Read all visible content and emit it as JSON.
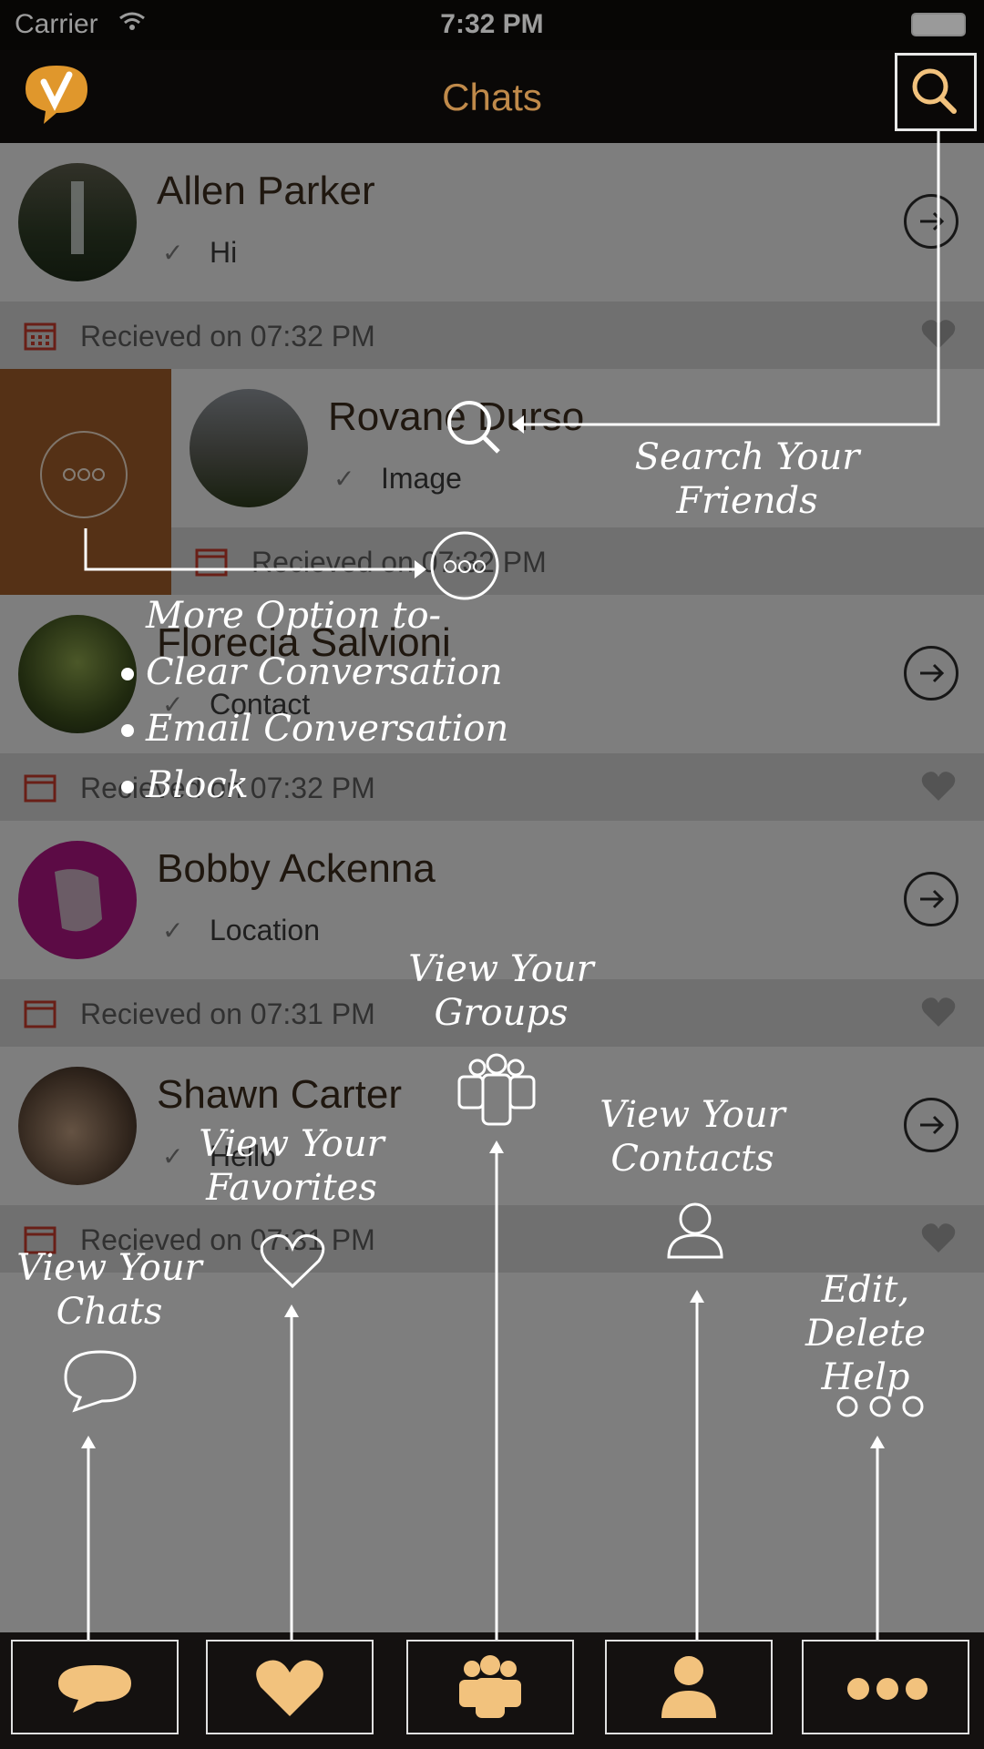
{
  "status_bar": {
    "carrier": "Carrier",
    "time": "7:32 PM"
  },
  "nav": {
    "title": "Chats"
  },
  "chats": [
    {
      "name": "Allen Parker",
      "message": "Hi",
      "received": "Recieved on 07:32 PM"
    },
    {
      "name": "Rovane Durso",
      "message": "Image",
      "received": "Recieved on 07:32 PM"
    },
    {
      "name": "Florecia Salvioni",
      "message": "Contact",
      "received": "Recieved on 07:32 PM"
    },
    {
      "name": "Bobby Ackenna",
      "message": "Location",
      "received": "Recieved on 07:31 PM"
    },
    {
      "name": "Shawn Carter",
      "message": "Hello",
      "received": "Recieved on 07:31 PM"
    }
  ],
  "annotations": {
    "search": "Search Your Friends",
    "more_title": "More Option to-",
    "more_items": [
      "Clear Conversation",
      "Email Conversation",
      "Block"
    ],
    "groups": "View Your Groups",
    "contacts": "View Your Contacts",
    "favorites": "View Your Favorites",
    "chats": "View Your Chats",
    "edit": "Edit, Delete Help"
  },
  "tabs": [
    "chats-tab",
    "favorites-tab",
    "groups-tab",
    "contacts-tab",
    "more-tab"
  ],
  "colors": {
    "accent": "#f2c27d",
    "brown": "#9b5a28",
    "overlay": "rgba(0,0,0,0.45)"
  }
}
